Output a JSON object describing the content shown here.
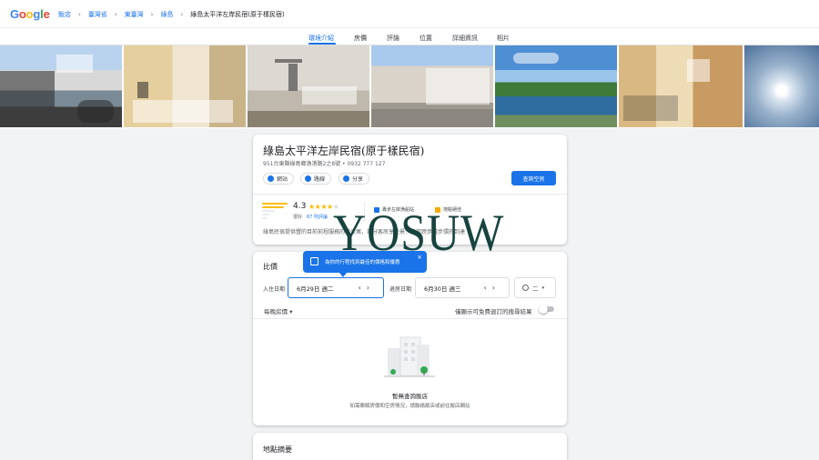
{
  "header": {
    "logo": [
      "G",
      "o",
      "o",
      "g",
      "l",
      "e"
    ],
    "logo_colors": [
      "#4285f4",
      "#ea4335",
      "#fbbc05",
      "#4285f4",
      "#34a853",
      "#ea4335"
    ],
    "breadcrumbs": [
      "飯店",
      "臺灣省",
      "東臺灣",
      "綠島",
      "綠島太平洋左岸民宿(原于樣民宿)"
    ]
  },
  "tabs": [
    "環境介紹",
    "房價",
    "評論",
    "位置",
    "詳細資訊",
    "相片"
  ],
  "hotel": {
    "name": "綠島太平洋左岸民宿(原于樣民宿)",
    "address": "951台東縣綠島鄉漁港路2之8號 • 0932 777 127",
    "chips": [
      "網站",
      "路線",
      "分享"
    ],
    "check_button": "查詢空房",
    "rating": "4.3",
    "stars_filled": 4,
    "rating_word": "很好",
    "reviews": "67 則評論",
    "features": [
      "專步左岸漁船站",
      "地點絕佳"
    ],
    "description": "綠島民宿提供豐的目前前程服務的鈴公寓，部分客房享受景：離岸跨步越步環的到達"
  },
  "watermark": "YOSUW",
  "pricing": {
    "title": "比價",
    "tooltip": "為你的行程找到最佳的價格和優惠",
    "checkin_label": "入住日期",
    "checkin": "6月29日 週二",
    "checkout_label": "退房日期",
    "checkout": "6月30日 週三",
    "guests": "二",
    "nightly": "每晚房價 ▾",
    "toggle_text": "僅顯示可免費退訂的搜尋結果",
    "empty_title": "暫無查詢飯店",
    "empty_sub": "如需瞭解房價和空房情況，請聯絡飯店或前往飯店網站"
  },
  "overview": {
    "title": "地點摘要"
  }
}
